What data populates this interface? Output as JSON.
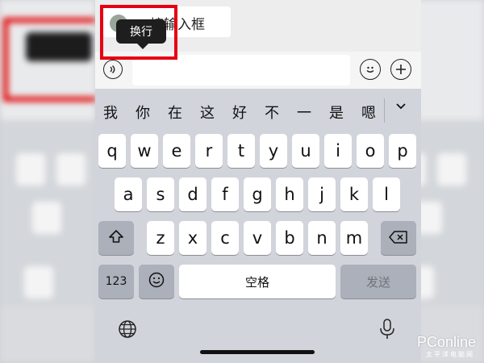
{
  "colors": {
    "highlight": "#e60012",
    "keyboard_bg": "#d1d4da",
    "key_bg": "#ffffff",
    "key_dark": "#abb0ba"
  },
  "chat": {
    "bubble_text": "接输入框"
  },
  "tooltip": {
    "label": "换行"
  },
  "input_bar": {
    "voice_icon": "voice-icon",
    "emoji_icon": "emoji-icon",
    "plus_icon": "plus-icon"
  },
  "candidates": [
    "我",
    "你",
    "在",
    "这",
    "好",
    "不",
    "一",
    "是",
    "嗯"
  ],
  "keyboard": {
    "row1": [
      "q",
      "w",
      "e",
      "r",
      "t",
      "y",
      "u",
      "i",
      "o",
      "p"
    ],
    "row2": [
      "a",
      "s",
      "d",
      "f",
      "g",
      "h",
      "j",
      "k",
      "l"
    ],
    "row3": [
      "z",
      "x",
      "c",
      "v",
      "b",
      "n",
      "m"
    ],
    "numbers_label": "123",
    "space_label": "空格",
    "send_label": "发送"
  },
  "watermark": {
    "brand": "PConline",
    "sub": "太平洋电脑网"
  }
}
